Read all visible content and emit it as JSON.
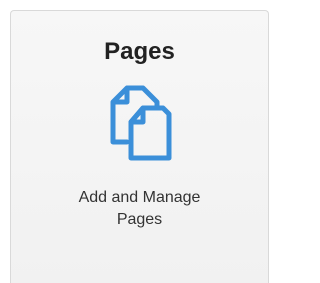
{
  "tile": {
    "title": "Pages",
    "icon": "pages-icon",
    "description_line1": "Add and Manage",
    "description_line2": "Pages"
  },
  "colors": {
    "icon": "#3b8fd9",
    "tile_background": "#f4f4f4",
    "tile_border": "#d9d9d9",
    "title_text": "#222222"
  }
}
